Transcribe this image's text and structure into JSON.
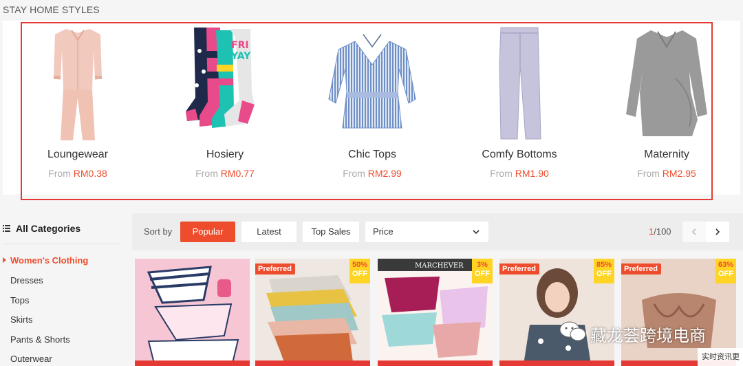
{
  "section_title": "STAY HOME STYLES",
  "price_prefix": "From",
  "styles": [
    {
      "name": "Loungewear",
      "price": "RM0.38",
      "image": "pink-satin-pajamas"
    },
    {
      "name": "Hosiery",
      "price": "RM0.77",
      "image": "colorful-socks"
    },
    {
      "name": "Chic Tops",
      "price": "RM2.99",
      "image": "striped-peplum-top"
    },
    {
      "name": "Comfy Bottoms",
      "price": "RM1.90",
      "image": "lavender-trousers"
    },
    {
      "name": "Maternity",
      "price": "RM2.95",
      "image": "grey-maternity-top"
    }
  ],
  "sidebar": {
    "header": "All Categories",
    "items": [
      {
        "label": "Women's Clothing",
        "active": true
      },
      {
        "label": "Dresses"
      },
      {
        "label": "Tops"
      },
      {
        "label": "Skirts"
      },
      {
        "label": "Pants & Shorts"
      },
      {
        "label": "Outerwear"
      }
    ]
  },
  "sortbar": {
    "label": "Sort by",
    "options": [
      "Popular",
      "Latest",
      "Top Sales"
    ],
    "active": "Popular",
    "price_select": "Price",
    "page_current": "1",
    "page_total": "/100"
  },
  "products": [
    {
      "preferred": "",
      "discount": "",
      "off": "",
      "image": "striped-underwear-set"
    },
    {
      "preferred": "Preferred",
      "discount": "50%",
      "off": "OFF",
      "image": "colored-panties-stack"
    },
    {
      "preferred": "",
      "discount": "3%",
      "off": "OFF",
      "image": "seamless-panties"
    },
    {
      "preferred": "Preferred",
      "discount": "85%",
      "off": "OFF",
      "image": "model-sleepwear"
    },
    {
      "preferred": "Preferred",
      "discount": "63%",
      "off": "OFF",
      "image": "bra-top"
    }
  ],
  "product3_brand": "MARCHEVER",
  "watermark": {
    "text": "藏龙荟跨境电商",
    "sub": "实时资讯更"
  },
  "colors": {
    "accent": "#ee4d2d",
    "highlight_outline": "#e53935",
    "badge_yellow": "#ffd424"
  }
}
